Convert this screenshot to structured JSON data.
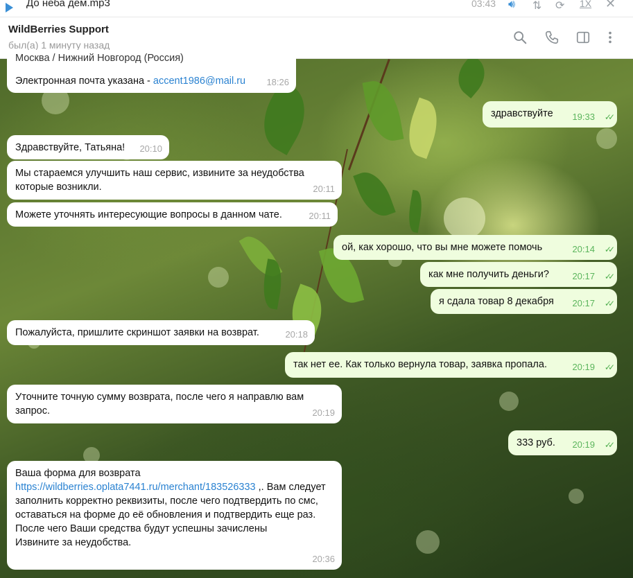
{
  "player": {
    "track": "До неба дем.mp3",
    "time": "03:43",
    "speed": "1X"
  },
  "header": {
    "name": "WildBerries Support",
    "status": "был(а) 1 минуту назад"
  },
  "messages": [
    {
      "dir": "in",
      "text_partial": "Москва / Нижний Новгород (Россия)",
      "text": "Электронная почта указана - ",
      "link": "accent1986@mail.ru",
      "time": "18:26"
    },
    {
      "dir": "out",
      "text": "здравствуйте",
      "time": "19:33"
    },
    {
      "dir": "in",
      "text": "Здравствуйте, Татьяна!",
      "time": "20:10"
    },
    {
      "dir": "in",
      "text": "Мы стараемся улучшить наш сервис, извините за неудобства которые возникли.",
      "time": "20:11"
    },
    {
      "dir": "in",
      "text": "Можете уточнять интересующие вопросы в данном чате.",
      "time": "20:11"
    },
    {
      "dir": "out",
      "text": "ой, как хорошо, что вы мне можете помочь",
      "time": "20:14"
    },
    {
      "dir": "out",
      "text": "как мне получить деньги?",
      "time": "20:17"
    },
    {
      "dir": "out",
      "text": "я сдала товар 8 декабря",
      "time": "20:17"
    },
    {
      "dir": "in",
      "text": "Пожалуйста, пришлите скриншот заявки на возврат.",
      "time": "20:18"
    },
    {
      "dir": "out",
      "text": "так нет ее. Как только вернула товар, заявка пропала.",
      "time": "20:19"
    },
    {
      "dir": "in",
      "text": "Уточните точную сумму возврата, после чего я направлю вам запрос.",
      "time": "20:19"
    },
    {
      "dir": "out",
      "text": "333 руб.",
      "time": "20:19"
    },
    {
      "dir": "in",
      "text_before": "Ваша форма для возврата",
      "link": "https://wildberries.oplata7441.ru/merchant/183526333",
      "text_after": ",. Вам следует заполнить корректно реквизиты, после чего подтвердить по смс, оставаться на форме до её обновления и подтвердить еще раз. После чего Ваши средства будут успешны зачислены",
      "text_end": "Извините за неудобства.",
      "time": "20:36"
    }
  ],
  "colors": {
    "accent": "#3a8fd6",
    "bubble_out": "#effdde",
    "check": "#4fae4e"
  }
}
